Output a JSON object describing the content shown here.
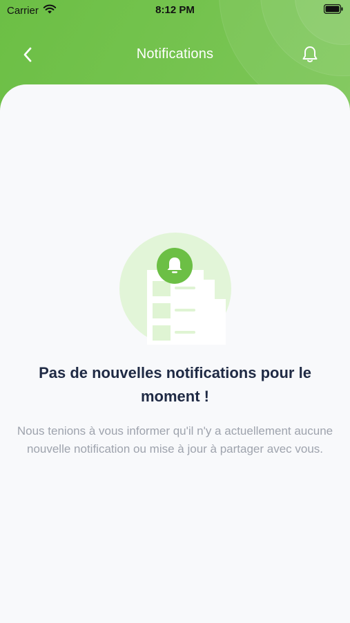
{
  "status_bar": {
    "carrier": "Carrier",
    "time": "8:12 PM"
  },
  "header": {
    "title": "Notifications",
    "back_icon": "chevron-left-icon",
    "bell_icon": "bell-icon"
  },
  "empty_state": {
    "title": "Pas de nouvelles notifications pour le moment !",
    "description": "Nous tenions à vous informer qu'il n'y a actuellement aucune nouvelle notification ou mise à jour à partager avec vous."
  },
  "colors": {
    "brand_green": "#6cbf45",
    "title_text": "#1f2a44",
    "desc_text": "#9ea3ad",
    "card_bg": "#f8f9fb"
  }
}
